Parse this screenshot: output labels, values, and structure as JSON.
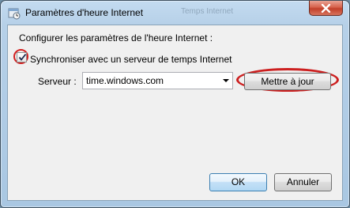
{
  "window": {
    "title": "Paramètres d'heure Internet",
    "background_title": "Temps Internet",
    "close_icon": "close-icon"
  },
  "main": {
    "heading": "Configurer les paramètres de l'heure Internet :",
    "sync_checkbox": {
      "label": "Synchroniser avec un serveur de temps Internet",
      "checked": true
    },
    "server": {
      "label": "Serveur :",
      "value": "time.windows.com"
    },
    "update_button": "Mettre à jour"
  },
  "footer": {
    "ok_label": "OK",
    "cancel_label": "Annuler"
  },
  "annotation_color": "#cc1f1f"
}
